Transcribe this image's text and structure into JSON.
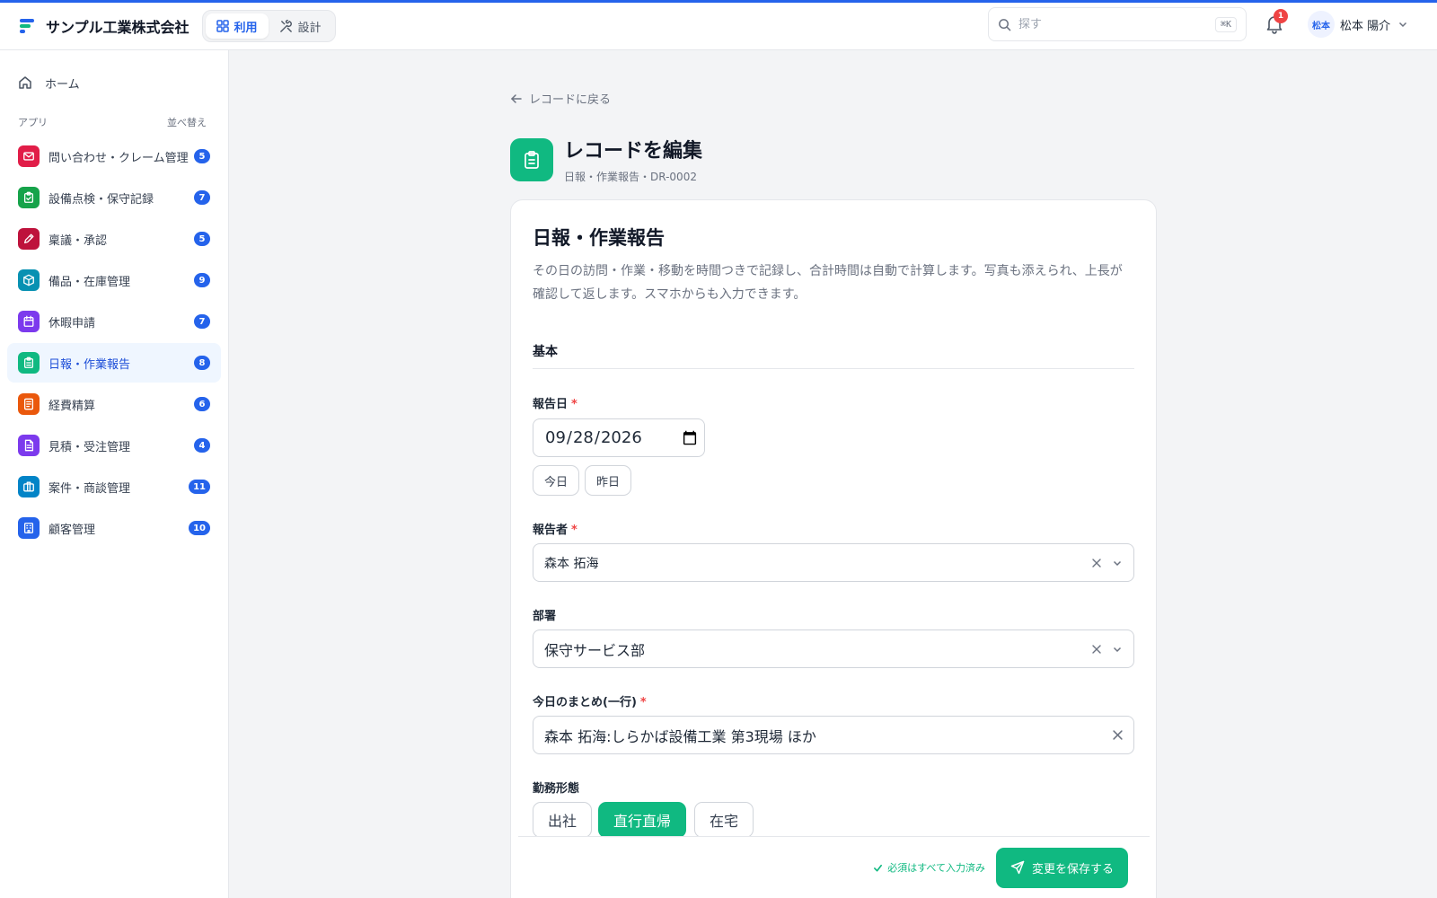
{
  "header": {
    "company": "サンプル工業株式会社",
    "modes": [
      {
        "label": "利用",
        "icon": "grid-icon",
        "active": true
      },
      {
        "label": "設計",
        "icon": "tools-icon",
        "active": false
      }
    ],
    "search_placeholder": "探す",
    "search_shortcut": "⌘K",
    "notification_count": "1",
    "user_initials": "松本",
    "user_name": "松本 陽介"
  },
  "sidebar": {
    "home_label": "ホーム",
    "apps_title": "アプリ",
    "sort_label": "並べ替え",
    "apps": [
      {
        "label": "問い合わせ・クレーム管理",
        "count": "5",
        "icon": "mail-icon",
        "color": "#e11d48",
        "active": false
      },
      {
        "label": "設備点検・保守記録",
        "count": "7",
        "icon": "clipboard-check-icon",
        "color": "#16a34a",
        "active": false
      },
      {
        "label": "稟議・承認",
        "count": "5",
        "icon": "pen-icon",
        "color": "#be123c",
        "active": false
      },
      {
        "label": "備品・在庫管理",
        "count": "9",
        "icon": "box-icon",
        "color": "#0891b2",
        "active": false
      },
      {
        "label": "休暇申請",
        "count": "7",
        "icon": "calendar-icon",
        "color": "#7c3aed",
        "active": false
      },
      {
        "label": "日報・作業報告",
        "count": "8",
        "icon": "clipboard-icon",
        "color": "#10b981",
        "active": true
      },
      {
        "label": "経費精算",
        "count": "6",
        "icon": "receipt-icon",
        "color": "#ea580c",
        "active": false
      },
      {
        "label": "見積・受注管理",
        "count": "4",
        "icon": "document-icon",
        "color": "#7c3aed",
        "active": false
      },
      {
        "label": "案件・商談管理",
        "count": "11",
        "icon": "briefcase-icon",
        "color": "#0284c7",
        "active": false
      },
      {
        "label": "顧客管理",
        "count": "10",
        "icon": "building-icon",
        "color": "#2563eb",
        "active": false
      }
    ]
  },
  "main": {
    "back_label": "レコードに戻る",
    "page_title": "レコードを編集",
    "page_subtitle": "日報・作業報告・DR-0002",
    "form_title": "日報・作業報告",
    "form_description": "その日の訪問・作業・移動を時間つきで記録し、合計時間は自動で計算します。写真も添えられ、上長が確認して返します。スマホからも入力できます。",
    "section_basic": "基本",
    "fields": {
      "report_date": {
        "label": "報告日",
        "value": "2026-09-28",
        "quick": [
          "今日",
          "昨日"
        ]
      },
      "reporter": {
        "label": "報告者",
        "value": "森本 拓海"
      },
      "department": {
        "label": "部署",
        "value": "保守サービス部"
      },
      "summary": {
        "label": "今日のまとめ(一行)",
        "value": "森本 拓海:しらかば設備工業 第3現場 ほか"
      },
      "work_style": {
        "label": "勤務形態",
        "options": [
          "出社",
          "直行直帰",
          "在宅"
        ],
        "selected": "直行直帰"
      }
    },
    "footer_status": "必須はすべて入力済み",
    "save_label": "変更を保存する"
  },
  "colors": {
    "accent": "#10b981",
    "primary": "#2563eb",
    "required": "#ef4444"
  }
}
